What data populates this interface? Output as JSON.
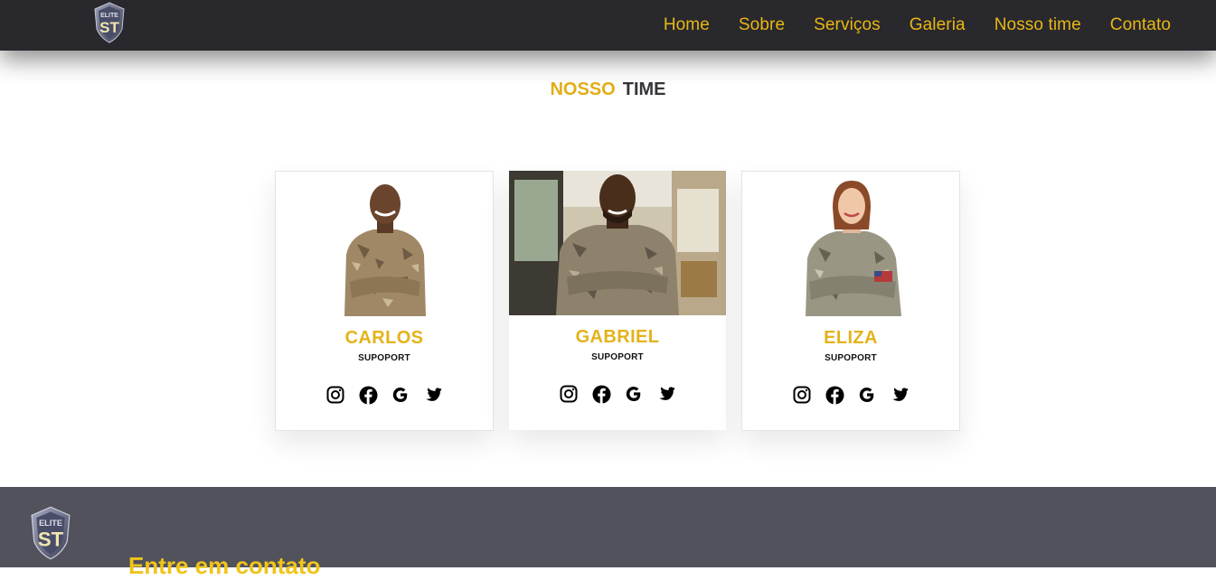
{
  "brand": {
    "logo_text_top": "ELITE",
    "logo_text_main": "ST"
  },
  "nav": {
    "items": [
      "Home",
      "Sobre",
      "Serviços",
      "Galeria",
      "Nosso time",
      "Contato"
    ]
  },
  "section": {
    "title_highlight": "NOSSO",
    "title_rest": "TIME"
  },
  "team": [
    {
      "name": "CARLOS",
      "role": "SUPOPORT"
    },
    {
      "name": "GABRIEL",
      "role": "SUPOPORT"
    },
    {
      "name": "ELIZA",
      "role": "SUPOPORT"
    }
  ],
  "social_icons": [
    "instagram-icon",
    "facebook-icon",
    "google-icon",
    "twitter-icon"
  ],
  "footer": {
    "heading": "Entre em contato"
  },
  "colors": {
    "accent": "#e9b713",
    "header_bg": "#28282d",
    "footer_bg": "#52525d",
    "heading_dark": "#35363a"
  }
}
